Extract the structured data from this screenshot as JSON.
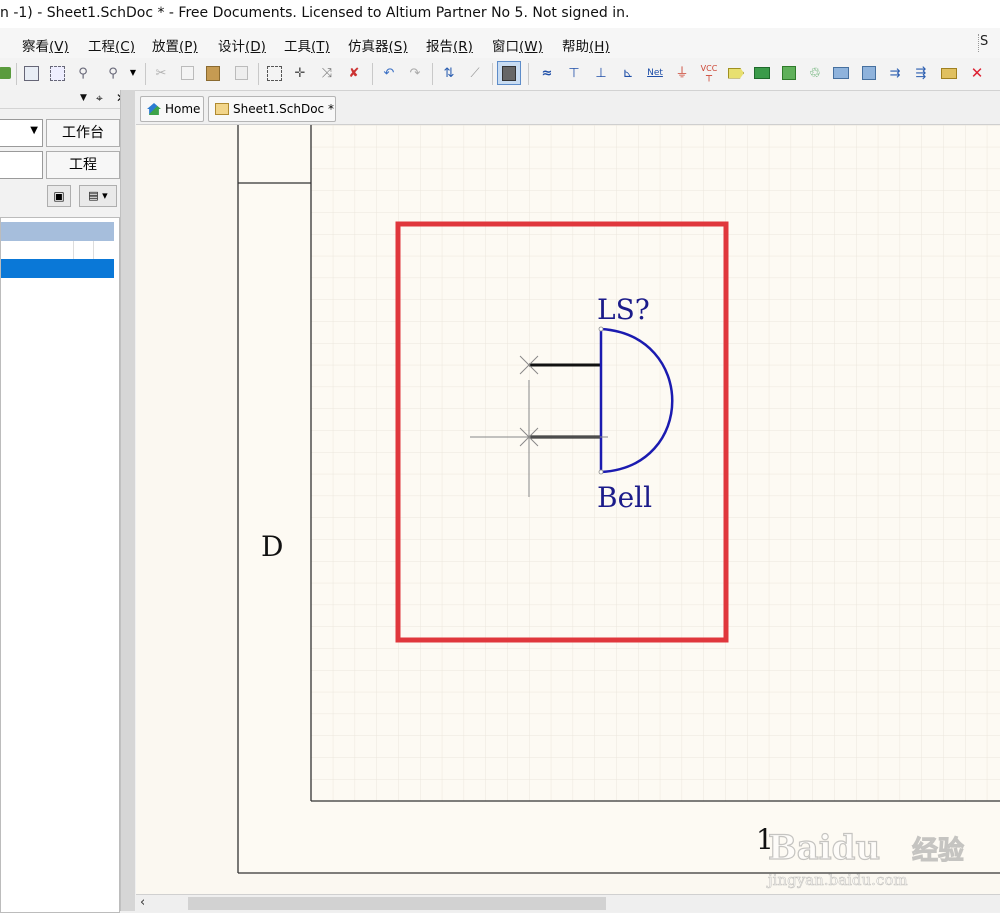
{
  "window": {
    "title": "n -1) - Sheet1.SchDoc * - Free Documents. Licensed to Altium Partner No 5. Not signed in."
  },
  "menu": {
    "items": [
      {
        "label": "察看",
        "key": "(V)"
      },
      {
        "label": "工程",
        "key": "(C)"
      },
      {
        "label": "放置",
        "key": "(P)"
      },
      {
        "label": "设计",
        "key": "(D)"
      },
      {
        "label": "工具",
        "key": "(T)"
      },
      {
        "label": "仿真器",
        "key": "(S)"
      },
      {
        "label": "报告",
        "key": "(R)"
      },
      {
        "label": "窗口",
        "key": "(W)"
      },
      {
        "label": "帮助",
        "key": "(H)"
      }
    ],
    "right_text": "S"
  },
  "toolbar": {
    "icons": [
      "open-icon",
      "zoom-fit-icon",
      "zoom-area-icon",
      "zoom-selected-icon",
      "zoom-dropdown-icon",
      "cut-icon",
      "copy-icon",
      "paste-icon",
      "rubber-stamp-icon",
      "select-area-icon",
      "move-icon",
      "deselect-icon",
      "clear-filter-icon",
      "undo-icon",
      "redo-icon",
      "hierarchy-icon",
      "cross-probe-icon",
      "browse-library-icon",
      "bus-icon",
      "bus-entry-icon",
      "wire-icon",
      "harness-icon",
      "net-label-icon",
      "gnd-port-icon",
      "vcc-port-icon",
      "port-icon",
      "part-icon",
      "sheet-symbol-icon",
      "sheet-entry-icon",
      "device-sheet-icon",
      "harness-entry-icon",
      "port-place-icon",
      "offsheet-icon",
      "parameter-icon",
      "no-erc-icon"
    ],
    "vcc_label": "VCC",
    "net_label": "Net",
    "close_glyph": "✕"
  },
  "left_panel": {
    "header_controls": {
      "dropdown": "▼",
      "pin": "⌖",
      "close": "✕"
    },
    "workspace_button": "工作台",
    "project_button": "工程",
    "combo_arrow": "▼"
  },
  "tabs": [
    {
      "label": "Home"
    },
    {
      "label": "Sheet1.SchDoc *"
    }
  ],
  "schematic": {
    "designator": "LS?",
    "comment": "Bell",
    "zone_row_label": "D",
    "zone_col_label": "1",
    "highlight_color": "#e0373c",
    "symbol_color": "#1b1bb0"
  },
  "watermark": {
    "brand": "Baidu",
    "cn": "经验",
    "url": "jingyan.baidu.com"
  }
}
